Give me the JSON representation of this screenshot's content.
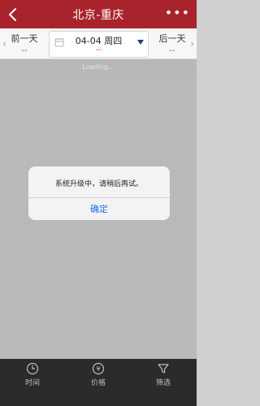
{
  "header": {
    "title": "北京-重庆",
    "more": "•••"
  },
  "datebar": {
    "prev_label": "前一天",
    "prev_sub": "--",
    "center_main": "04-04 周四",
    "center_sub": "--",
    "next_label": "后一天",
    "next_sub": "--"
  },
  "loading": {
    "text": "Loading..."
  },
  "dialog": {
    "message": "系统升级中，请稍后再试。",
    "button": "确定"
  },
  "tabs": [
    {
      "label": "时间",
      "icon": "clock-icon"
    },
    {
      "label": "价格",
      "icon": "price-icon"
    },
    {
      "label": "筛选",
      "icon": "filter-icon"
    }
  ],
  "colors": {
    "header_bg": "#a8232b",
    "accent": "#1a73e8",
    "tabbar_bg": "#2b2b2b"
  }
}
